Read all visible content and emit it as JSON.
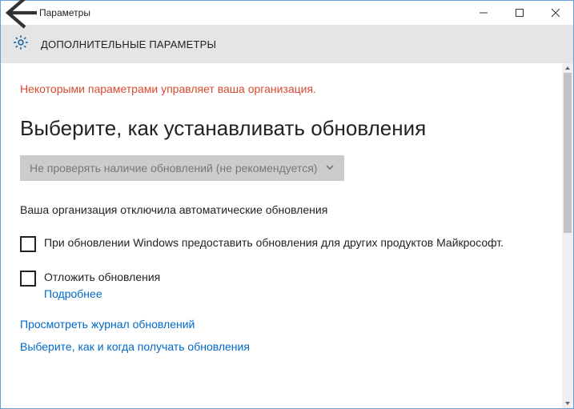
{
  "titlebar": {
    "title": "Параметры"
  },
  "header": {
    "heading": "ДОПОЛНИТЕЛЬНЫЕ ПАРАМЕТРЫ"
  },
  "warning": "Некоторыми параметрами управляет ваша организация.",
  "section_title": "Выберите, как устанавливать обновления",
  "dropdown": {
    "selected": "Не проверять наличие обновлений (не рекомендуется)"
  },
  "org_note": "Ваша организация отключила автоматические обновления",
  "checkbox1": {
    "label": "При обновлении Windows предоставить обновления для других продуктов Майкрософт.",
    "checked": false
  },
  "checkbox2": {
    "label": "Отложить обновления",
    "checked": false,
    "more_label": "Подробнее"
  },
  "links": {
    "history": "Просмотреть журнал обновлений",
    "delivery": "Выберите, как и когда получать обновления"
  },
  "colors": {
    "accent": "#0068c6",
    "warning": "#d94a2e"
  }
}
